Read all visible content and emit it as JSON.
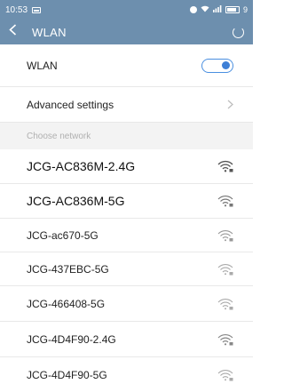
{
  "statusbar": {
    "time": "10:53",
    "battery": "9"
  },
  "titlebar": {
    "title": "WLAN"
  },
  "settings": {
    "wlan_label": "WLAN",
    "wlan_enabled": true,
    "advanced_label": "Advanced settings"
  },
  "section": {
    "choose_network": "Choose network"
  },
  "networks": [
    {
      "ssid": "JCG-AC836M-2.4G",
      "secured": true
    },
    {
      "ssid": "JCG-AC836M-5G",
      "secured": true
    },
    {
      "ssid": "JCG-ac670-5G",
      "secured": true
    },
    {
      "ssid": "JCG-437EBC-5G",
      "secured": true
    },
    {
      "ssid": "JCG-466408-5G",
      "secured": true
    },
    {
      "ssid": "JCG-4D4F90-2.4G",
      "secured": true
    },
    {
      "ssid": "JCG-4D4F90-5G",
      "secured": true
    }
  ],
  "colors": {
    "header_bg": "#6d8fae",
    "toggle_accent": "#3d7fd6"
  }
}
